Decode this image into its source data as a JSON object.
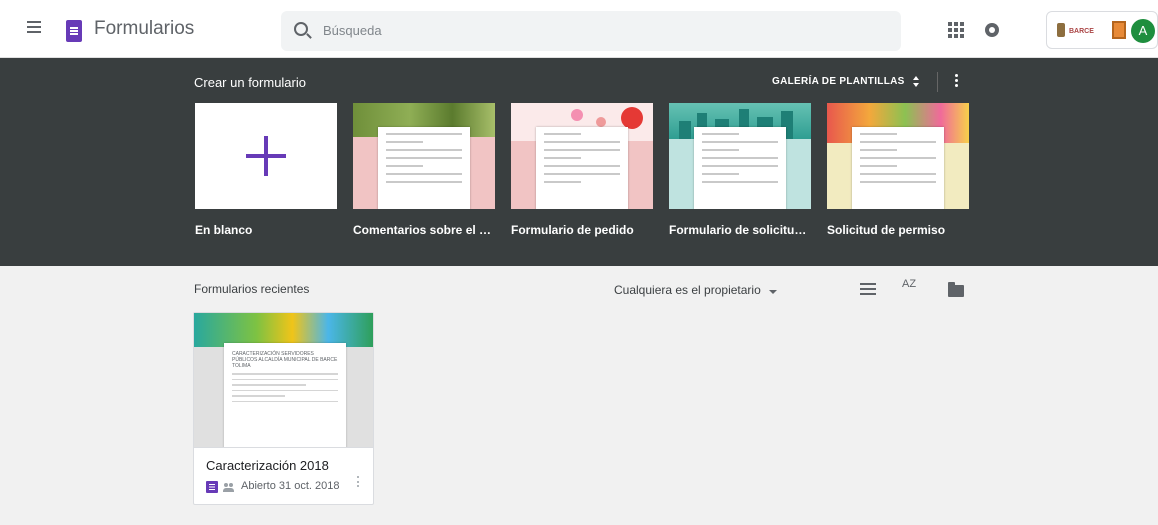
{
  "header": {
    "app_title": "Formularios",
    "search_placeholder": "Búsqueda",
    "avatar_letter": "A",
    "org_logo_text": "BARCE"
  },
  "templates": {
    "title": "Crear un formulario",
    "gallery_label": "GALERÍA DE PLANTILLAS",
    "items": [
      {
        "label": "En blanco"
      },
      {
        "label": "Comentarios sobre el ev..."
      },
      {
        "label": "Formulario de pedido"
      },
      {
        "label": "Formulario de solicitud ..."
      },
      {
        "label": "Solicitud de permiso"
      }
    ]
  },
  "recent": {
    "title": "Formularios recientes",
    "owner_filter": "Cualquiera es el propietario",
    "sort_label": "AZ",
    "forms": [
      {
        "name": "Caracterización 2018",
        "meta": "Abierto 31 oct. 2018",
        "thumb_heading": "CARACTERIZACIÓN SERVIDORES PÚBLICOS ALCALDÍA MUNICIPAL DE BARCE TOLIMA"
      }
    ]
  },
  "colors": {
    "accent": "#673ab7",
    "dark_band": "#393e3f",
    "page_bg": "#f1f1f1"
  },
  "icons": [
    "menu-icon",
    "forms-logo-icon",
    "search-icon",
    "apps-grid-icon",
    "notifications-icon",
    "sort-icon",
    "list-view-icon",
    "folder-icon",
    "more-icon",
    "people-icon"
  ]
}
